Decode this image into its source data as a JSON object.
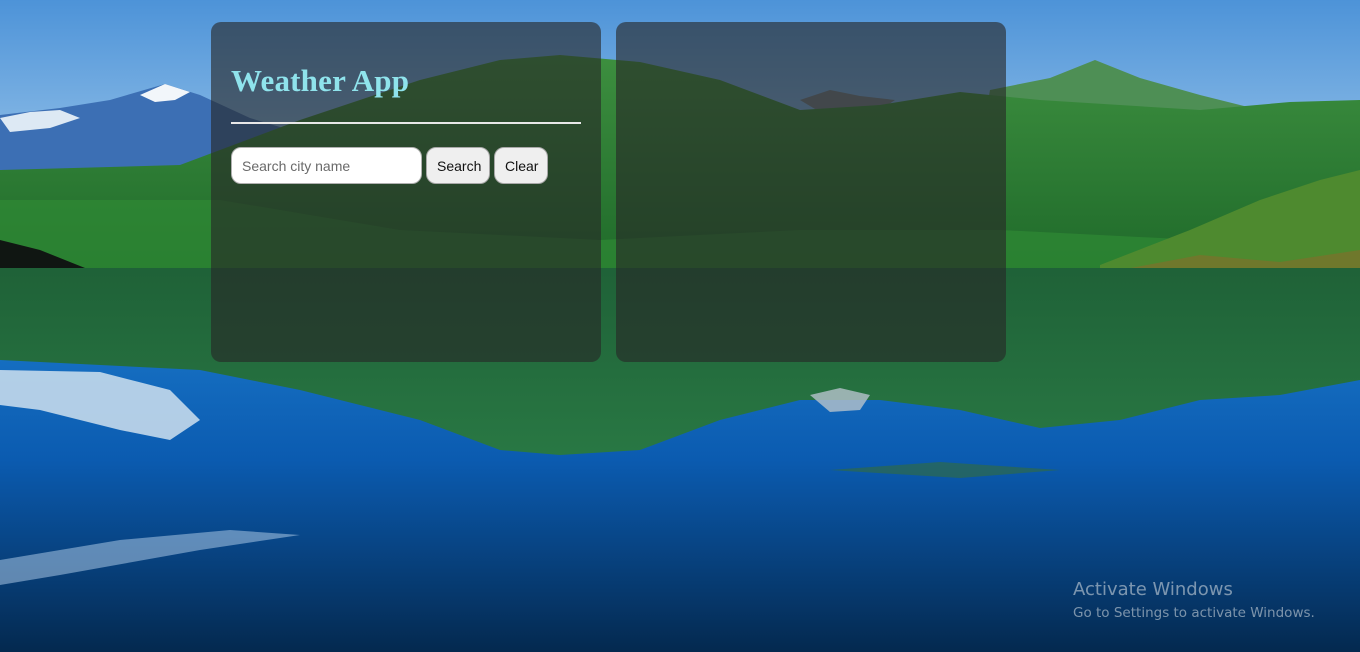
{
  "app": {
    "title": "Weather App"
  },
  "search": {
    "placeholder": "Search city name",
    "value": "",
    "search_label": "Search",
    "clear_label": "Clear"
  },
  "watermark": {
    "title": "Activate Windows",
    "subtitle": "Go to Settings to activate Windows."
  },
  "colors": {
    "title_accent": "#8fe3ec",
    "panel_overlay": "rgba(38,38,38,0.62)"
  }
}
